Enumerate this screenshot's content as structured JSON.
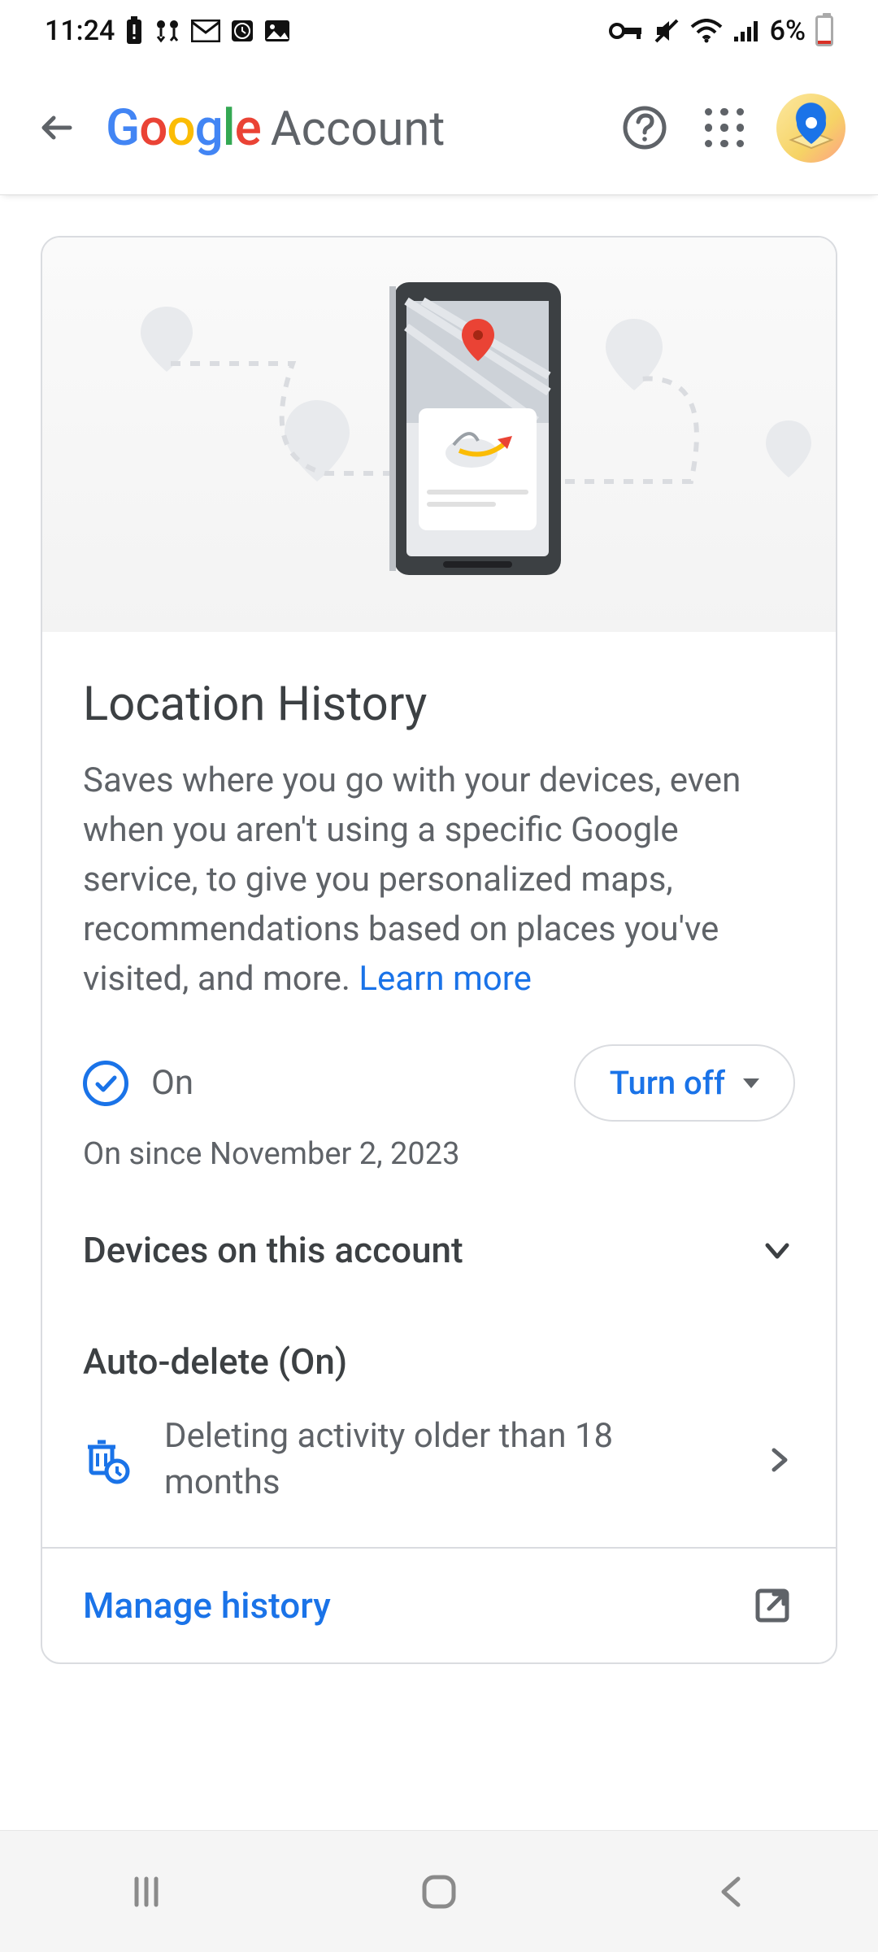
{
  "status_bar": {
    "time": "11:24",
    "battery_pct": "6%"
  },
  "app_bar": {
    "logo_google": "Google",
    "logo_account": "Account"
  },
  "card": {
    "title": "Location History",
    "description": "Saves where you go with your devices, even when you aren't using a specific Google service, to give you personalized maps, recommendations based on places you've visited, and more. ",
    "learn_more": "Learn more",
    "status_label": "On",
    "status_since": "On since November 2, 2023",
    "turn_off_label": "Turn off",
    "devices_label": "Devices on this account",
    "autodelete_title": "Auto-delete (On)",
    "autodelete_detail": "Deleting activity older than 18 months",
    "manage_history": "Manage history"
  },
  "colors": {
    "google_blue": "#1a73e8",
    "text_primary": "#3c4043",
    "text_secondary": "#5f6368",
    "border": "#dadce0"
  }
}
